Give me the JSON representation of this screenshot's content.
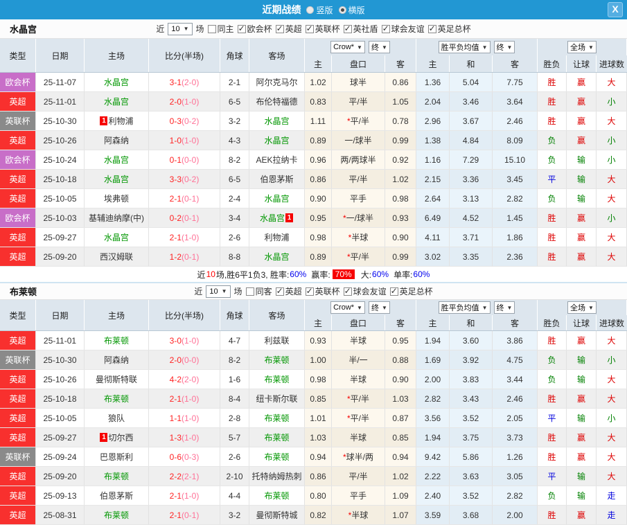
{
  "league_colors": {
    "欧会杯": "#c86ec8",
    "英超": "#f8302e",
    "英联杯": "#8a8a8a"
  },
  "titlebar": {
    "title": "近期战绩",
    "radios": [
      {
        "label": "竖版",
        "checked": false
      },
      {
        "label": "横版",
        "checked": true
      }
    ],
    "close_label": "X"
  },
  "columns": {
    "type": "类型",
    "date": "日期",
    "home": "主场",
    "score": "比分(半场)",
    "corner": "角球",
    "away": "客场",
    "host": "主",
    "handicap": "盘口",
    "guest": "客",
    "host2": "主",
    "draw": "和",
    "guest2": "客",
    "result": "胜负",
    "give": "让球",
    "goals": "进球数",
    "odds_source_dd": "Crow*",
    "final_dd": "终",
    "mean_dd": "胜平负均值",
    "final2_dd": "终",
    "scope_dd": "全场"
  },
  "sections": [
    {
      "team": "水晶宫",
      "filter": {
        "near": "近",
        "count": "10",
        "games": "场",
        "same": "同主",
        "same_checked": false,
        "leagues": [
          "欧会杯",
          "英超",
          "英联杯",
          "英社盾",
          "球会友谊",
          "英足总杯"
        ]
      },
      "rows": [
        {
          "league": "欧会杯",
          "date": "25-11-07",
          "home": "水晶宫",
          "home_focus": true,
          "home_card": "",
          "score": "3-1",
          "half": "(2-0)",
          "corner": "2-1",
          "away": "阿尔克马尔",
          "away_focus": false,
          "away_card": "",
          "h_odds": "1.02",
          "handicap_star": false,
          "handicap": "球半",
          "a_odds": "0.86",
          "m_home": "1.36",
          "m_draw": "5.04",
          "m_away": "7.75",
          "result": "胜",
          "give": "赢",
          "goal": "大"
        },
        {
          "league": "英超",
          "date": "25-11-01",
          "home": "水晶宫",
          "home_focus": true,
          "home_card": "",
          "score": "2-0",
          "half": "(1-0)",
          "corner": "6-5",
          "away": "布伦特福德",
          "away_focus": false,
          "away_card": "",
          "h_odds": "0.83",
          "handicap_star": false,
          "handicap": "平/半",
          "a_odds": "1.05",
          "m_home": "2.04",
          "m_draw": "3.46",
          "m_away": "3.64",
          "result": "胜",
          "give": "赢",
          "goal": "小"
        },
        {
          "league": "英联杯",
          "date": "25-10-30",
          "home": "利物浦",
          "home_focus": false,
          "home_card": "1",
          "score": "0-3",
          "half": "(0-2)",
          "corner": "3-2",
          "away": "水晶宫",
          "away_focus": true,
          "away_card": "",
          "h_odds": "1.11",
          "handicap_star": true,
          "handicap": "平/半",
          "a_odds": "0.78",
          "m_home": "2.96",
          "m_draw": "3.67",
          "m_away": "2.46",
          "result": "胜",
          "give": "赢",
          "goal": "大"
        },
        {
          "league": "英超",
          "date": "25-10-26",
          "home": "阿森纳",
          "home_focus": false,
          "home_card": "",
          "score": "1-0",
          "half": "(1-0)",
          "corner": "4-3",
          "away": "水晶宫",
          "away_focus": true,
          "away_card": "",
          "h_odds": "0.89",
          "handicap_star": false,
          "handicap": "一/球半",
          "a_odds": "0.99",
          "m_home": "1.38",
          "m_draw": "4.84",
          "m_away": "8.09",
          "result": "负",
          "give": "赢",
          "goal": "小"
        },
        {
          "league": "欧会杯",
          "date": "25-10-24",
          "home": "水晶宫",
          "home_focus": true,
          "home_card": "",
          "score": "0-1",
          "half": "(0-0)",
          "corner": "8-2",
          "away": "AEK拉纳卡",
          "away_focus": false,
          "away_card": "",
          "h_odds": "0.96",
          "handicap_star": false,
          "handicap": "两/两球半",
          "a_odds": "0.92",
          "m_home": "1.16",
          "m_draw": "7.29",
          "m_away": "15.10",
          "result": "负",
          "give": "输",
          "goal": "小"
        },
        {
          "league": "英超",
          "date": "25-10-18",
          "home": "水晶宫",
          "home_focus": true,
          "home_card": "",
          "score": "3-3",
          "half": "(0-2)",
          "corner": "6-5",
          "away": "伯恩茅斯",
          "away_focus": false,
          "away_card": "",
          "h_odds": "0.86",
          "handicap_star": false,
          "handicap": "平/半",
          "a_odds": "1.02",
          "m_home": "2.15",
          "m_draw": "3.36",
          "m_away": "3.45",
          "result": "平",
          "give": "输",
          "goal": "大"
        },
        {
          "league": "英超",
          "date": "25-10-05",
          "home": "埃弗顿",
          "home_focus": false,
          "home_card": "",
          "score": "2-1",
          "half": "(0-1)",
          "corner": "2-4",
          "away": "水晶宫",
          "away_focus": true,
          "away_card": "",
          "h_odds": "0.90",
          "handicap_star": false,
          "handicap": "平手",
          "a_odds": "0.98",
          "m_home": "2.64",
          "m_draw": "3.13",
          "m_away": "2.82",
          "result": "负",
          "give": "输",
          "goal": "大"
        },
        {
          "league": "欧会杯",
          "date": "25-10-03",
          "home": "基辅迪纳摩(中)",
          "home_focus": false,
          "home_card": "",
          "score": "0-2",
          "half": "(0-1)",
          "corner": "3-4",
          "away": "水晶宫",
          "away_focus": true,
          "away_card": "1",
          "h_odds": "0.95",
          "handicap_star": true,
          "handicap": "一/球半",
          "a_odds": "0.93",
          "m_home": "6.49",
          "m_draw": "4.52",
          "m_away": "1.45",
          "result": "胜",
          "give": "赢",
          "goal": "小"
        },
        {
          "league": "英超",
          "date": "25-09-27",
          "home": "水晶宫",
          "home_focus": true,
          "home_card": "",
          "score": "2-1",
          "half": "(1-0)",
          "corner": "2-6",
          "away": "利物浦",
          "away_focus": false,
          "away_card": "",
          "h_odds": "0.98",
          "handicap_star": true,
          "handicap": "半球",
          "a_odds": "0.90",
          "m_home": "4.11",
          "m_draw": "3.71",
          "m_away": "1.86",
          "result": "胜",
          "give": "赢",
          "goal": "大"
        },
        {
          "league": "英超",
          "date": "25-09-20",
          "home": "西汉姆联",
          "home_focus": false,
          "home_card": "",
          "score": "1-2",
          "half": "(0-1)",
          "corner": "8-8",
          "away": "水晶宫",
          "away_focus": true,
          "away_card": "",
          "h_odds": "0.89",
          "handicap_star": true,
          "handicap": "平/半",
          "a_odds": "0.99",
          "m_home": "3.02",
          "m_draw": "3.35",
          "m_away": "2.36",
          "result": "胜",
          "give": "赢",
          "goal": "大"
        }
      ],
      "summary": {
        "near": "近",
        "count": "10",
        "record": "场,胜6平1负3, 胜率:",
        "win_rate": "60%",
        "profit_label": "赢率:",
        "profit_rate": "70%",
        "big_label": "大:",
        "big_rate": "60%",
        "single_label": "单率:",
        "single_rate": "60%"
      }
    },
    {
      "team": "布莱顿",
      "filter": {
        "near": "近",
        "count": "10",
        "games": "场",
        "same": "同客",
        "same_checked": false,
        "leagues": [
          "英超",
          "英联杯",
          "球会友谊",
          "英足总杯"
        ]
      },
      "rows": [
        {
          "league": "英超",
          "date": "25-11-01",
          "home": "布莱顿",
          "home_focus": true,
          "home_card": "",
          "score": "3-0",
          "half": "(1-0)",
          "corner": "4-7",
          "away": "利兹联",
          "away_focus": false,
          "away_card": "",
          "h_odds": "0.93",
          "handicap_star": false,
          "handicap": "半球",
          "a_odds": "0.95",
          "m_home": "1.94",
          "m_draw": "3.60",
          "m_away": "3.86",
          "result": "胜",
          "give": "赢",
          "goal": "大"
        },
        {
          "league": "英联杯",
          "date": "25-10-30",
          "home": "阿森纳",
          "home_focus": false,
          "home_card": "",
          "score": "2-0",
          "half": "(0-0)",
          "corner": "8-2",
          "away": "布莱顿",
          "away_focus": true,
          "away_card": "",
          "h_odds": "1.00",
          "handicap_star": false,
          "handicap": "半/一",
          "a_odds": "0.88",
          "m_home": "1.69",
          "m_draw": "3.92",
          "m_away": "4.75",
          "result": "负",
          "give": "输",
          "goal": "小"
        },
        {
          "league": "英超",
          "date": "25-10-26",
          "home": "曼彻斯特联",
          "home_focus": false,
          "home_card": "",
          "score": "4-2",
          "half": "(2-0)",
          "corner": "1-6",
          "away": "布莱顿",
          "away_focus": true,
          "away_card": "",
          "h_odds": "0.98",
          "handicap_star": false,
          "handicap": "半球",
          "a_odds": "0.90",
          "m_home": "2.00",
          "m_draw": "3.83",
          "m_away": "3.44",
          "result": "负",
          "give": "输",
          "goal": "大"
        },
        {
          "league": "英超",
          "date": "25-10-18",
          "home": "布莱顿",
          "home_focus": true,
          "home_card": "",
          "score": "2-1",
          "half": "(1-0)",
          "corner": "8-4",
          "away": "纽卡斯尔联",
          "away_focus": false,
          "away_card": "",
          "h_odds": "0.85",
          "handicap_star": true,
          "handicap": "平/半",
          "a_odds": "1.03",
          "m_home": "2.82",
          "m_draw": "3.43",
          "m_away": "2.46",
          "result": "胜",
          "give": "赢",
          "goal": "大"
        },
        {
          "league": "英超",
          "date": "25-10-05",
          "home": "狼队",
          "home_focus": false,
          "home_card": "",
          "score": "1-1",
          "half": "(1-0)",
          "corner": "2-8",
          "away": "布莱顿",
          "away_focus": true,
          "away_card": "",
          "h_odds": "1.01",
          "handicap_star": true,
          "handicap": "平/半",
          "a_odds": "0.87",
          "m_home": "3.56",
          "m_draw": "3.52",
          "m_away": "2.05",
          "result": "平",
          "give": "输",
          "goal": "小"
        },
        {
          "league": "英超",
          "date": "25-09-27",
          "home": "切尔西",
          "home_focus": false,
          "home_card": "1",
          "score": "1-3",
          "half": "(1-0)",
          "corner": "5-7",
          "away": "布莱顿",
          "away_focus": true,
          "away_card": "",
          "h_odds": "1.03",
          "handicap_star": false,
          "handicap": "半球",
          "a_odds": "0.85",
          "m_home": "1.94",
          "m_draw": "3.75",
          "m_away": "3.73",
          "result": "胜",
          "give": "赢",
          "goal": "大"
        },
        {
          "league": "英联杯",
          "date": "25-09-24",
          "home": "巴恩斯利",
          "home_focus": false,
          "home_card": "",
          "score": "0-6",
          "half": "(0-3)",
          "corner": "2-6",
          "away": "布莱顿",
          "away_focus": true,
          "away_card": "",
          "h_odds": "0.94",
          "handicap_star": true,
          "handicap": "球半/两",
          "a_odds": "0.94",
          "m_home": "9.42",
          "m_draw": "5.86",
          "m_away": "1.26",
          "result": "胜",
          "give": "赢",
          "goal": "大"
        },
        {
          "league": "英超",
          "date": "25-09-20",
          "home": "布莱顿",
          "home_focus": true,
          "home_card": "",
          "score": "2-2",
          "half": "(2-1)",
          "corner": "2-10",
          "away": "托特纳姆热刺",
          "away_focus": false,
          "away_card": "",
          "h_odds": "0.86",
          "handicap_star": false,
          "handicap": "平/半",
          "a_odds": "1.02",
          "m_home": "2.22",
          "m_draw": "3.63",
          "m_away": "3.05",
          "result": "平",
          "give": "输",
          "goal": "大"
        },
        {
          "league": "英超",
          "date": "25-09-13",
          "home": "伯恩茅斯",
          "home_focus": false,
          "home_card": "",
          "score": "2-1",
          "half": "(1-0)",
          "corner": "4-4",
          "away": "布莱顿",
          "away_focus": true,
          "away_card": "",
          "h_odds": "0.80",
          "handicap_star": false,
          "handicap": "平手",
          "a_odds": "1.09",
          "m_home": "2.40",
          "m_draw": "3.52",
          "m_away": "2.82",
          "result": "负",
          "give": "输",
          "goal": "走"
        },
        {
          "league": "英超",
          "date": "25-08-31",
          "home": "布莱顿",
          "home_focus": true,
          "home_card": "",
          "score": "2-1",
          "half": "(0-1)",
          "corner": "3-2",
          "away": "曼彻斯特城",
          "away_focus": false,
          "away_card": "",
          "h_odds": "0.82",
          "handicap_star": true,
          "handicap": "半球",
          "a_odds": "1.07",
          "m_home": "3.59",
          "m_draw": "3.68",
          "m_away": "2.00",
          "result": "胜",
          "give": "赢",
          "goal": "走"
        }
      ]
    }
  ]
}
